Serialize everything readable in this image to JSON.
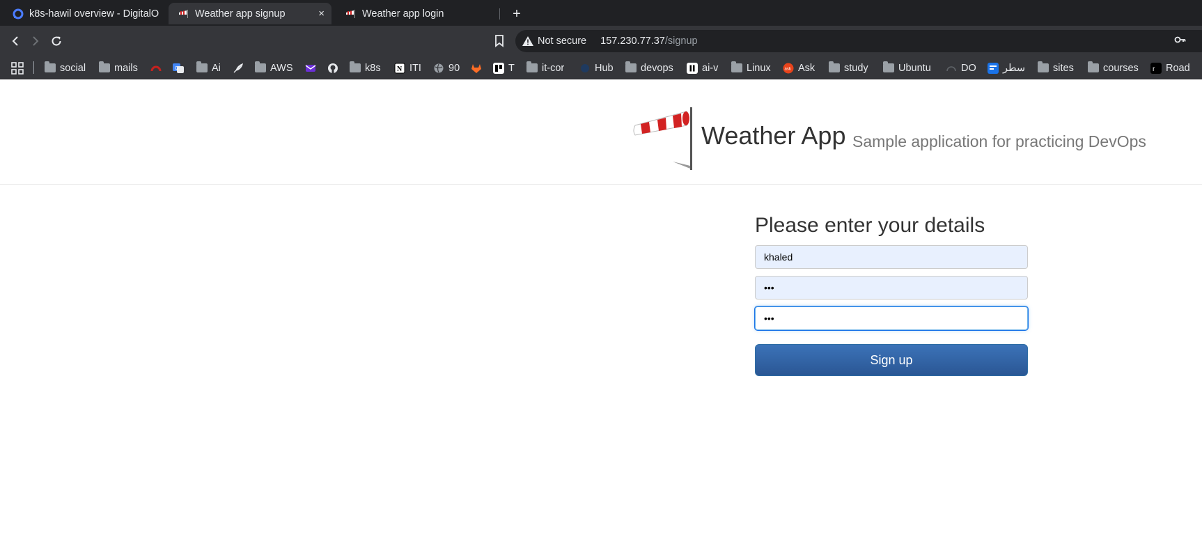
{
  "browser": {
    "tabs": [
      {
        "title": "k8s-hawil overview - DigitalO",
        "active": false
      },
      {
        "title": "Weather app signup",
        "active": true
      },
      {
        "title": "Weather app login",
        "active": false
      }
    ],
    "new_tab_label": "+",
    "close_label": "×",
    "security_label": "Not secure",
    "url_host": "157.230.77.37",
    "url_path": "/signup",
    "bookmarks": [
      {
        "label": "social",
        "icon": "folder-icon"
      },
      {
        "label": "mails",
        "icon": "folder-icon"
      },
      {
        "label": "",
        "icon": "speedometer-icon"
      },
      {
        "label": "",
        "icon": "translate-icon"
      },
      {
        "label": "Ai",
        "icon": "folder-icon"
      },
      {
        "label": "",
        "icon": "feather-icon"
      },
      {
        "label": "AWS",
        "icon": "folder-icon"
      },
      {
        "label": "",
        "icon": "mail-envelope-icon"
      },
      {
        "label": "",
        "icon": "github-icon"
      },
      {
        "label": "k8s",
        "icon": "folder-icon"
      },
      {
        "label": "ITI",
        "icon": "notion-icon"
      },
      {
        "label": "90",
        "icon": "globe-icon"
      },
      {
        "label": "",
        "icon": "gitlab-icon"
      },
      {
        "label": "T",
        "icon": "trello-icon"
      },
      {
        "label": "it-cor",
        "icon": "folder-icon"
      },
      {
        "label": "Hub",
        "icon": "docker-icon"
      },
      {
        "label": "devops",
        "icon": "folder-icon"
      },
      {
        "label": "ai-v",
        "icon": "pause-icon"
      },
      {
        "label": "Linux",
        "icon": "folder-icon"
      },
      {
        "label": "Ask",
        "icon": "ask-icon"
      },
      {
        "label": "study",
        "icon": "folder-icon"
      },
      {
        "label": "Ubuntu",
        "icon": "folder-icon"
      },
      {
        "label": "DO",
        "icon": "gauge-icon"
      },
      {
        "label": "سطر",
        "icon": "satr-icon"
      },
      {
        "label": "sites",
        "icon": "folder-icon"
      },
      {
        "label": "courses",
        "icon": "folder-icon"
      },
      {
        "label": "Road",
        "icon": "roadmap-icon"
      }
    ]
  },
  "header": {
    "brand": "Weather App",
    "tagline": "Sample application for practicing DevOps"
  },
  "form": {
    "heading": "Please enter your details",
    "username_value": "khaled",
    "password_value": "•••",
    "confirm_password_value": "•••",
    "submit_label": "Sign up"
  },
  "colors": {
    "button_blue": "#2a5694",
    "autofill_bg": "#e8f0fe",
    "windsock_red": "#d22222"
  }
}
